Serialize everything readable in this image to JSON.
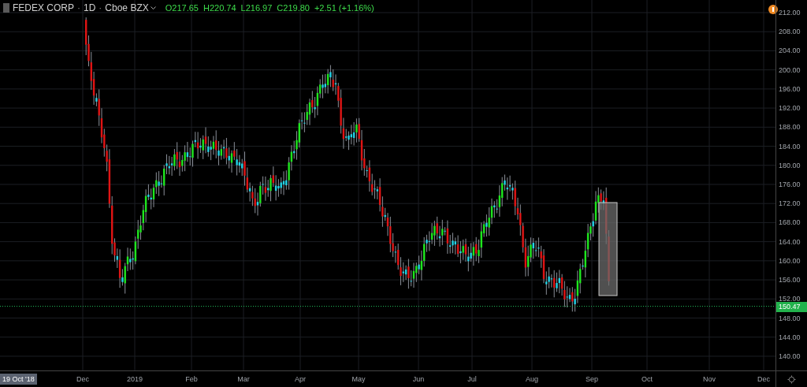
{
  "header": {
    "symbol": "FEDEX CORP",
    "separator": "·",
    "interval": "1D",
    "exchange": "Cboe BZX",
    "ohlc": [
      {
        "label": "O",
        "value": "217.65"
      },
      {
        "label": "H",
        "value": "220.74"
      },
      {
        "label": "L",
        "value": "216.97"
      },
      {
        "label": "C",
        "value": "219.80"
      }
    ],
    "change": "+2.51 (+1.16%)"
  },
  "price_axis": {
    "ticks": [
      "212.00",
      "208.00",
      "204.00",
      "200.00",
      "196.00",
      "192.00",
      "188.00",
      "184.00",
      "180.00",
      "176.00",
      "172.00",
      "168.00",
      "164.00",
      "160.00",
      "156.00",
      "152.00",
      "148.00",
      "144.00",
      "140.00"
    ],
    "last_price": "150.47"
  },
  "time_axis": {
    "cursor_date": "19 Oct '18",
    "ticks": [
      "Dec",
      "2019",
      "Feb",
      "Mar",
      "Apr",
      "May",
      "Jun",
      "Jul",
      "Aug",
      "Sep",
      "Oct",
      "Nov",
      "Dec"
    ]
  }
}
